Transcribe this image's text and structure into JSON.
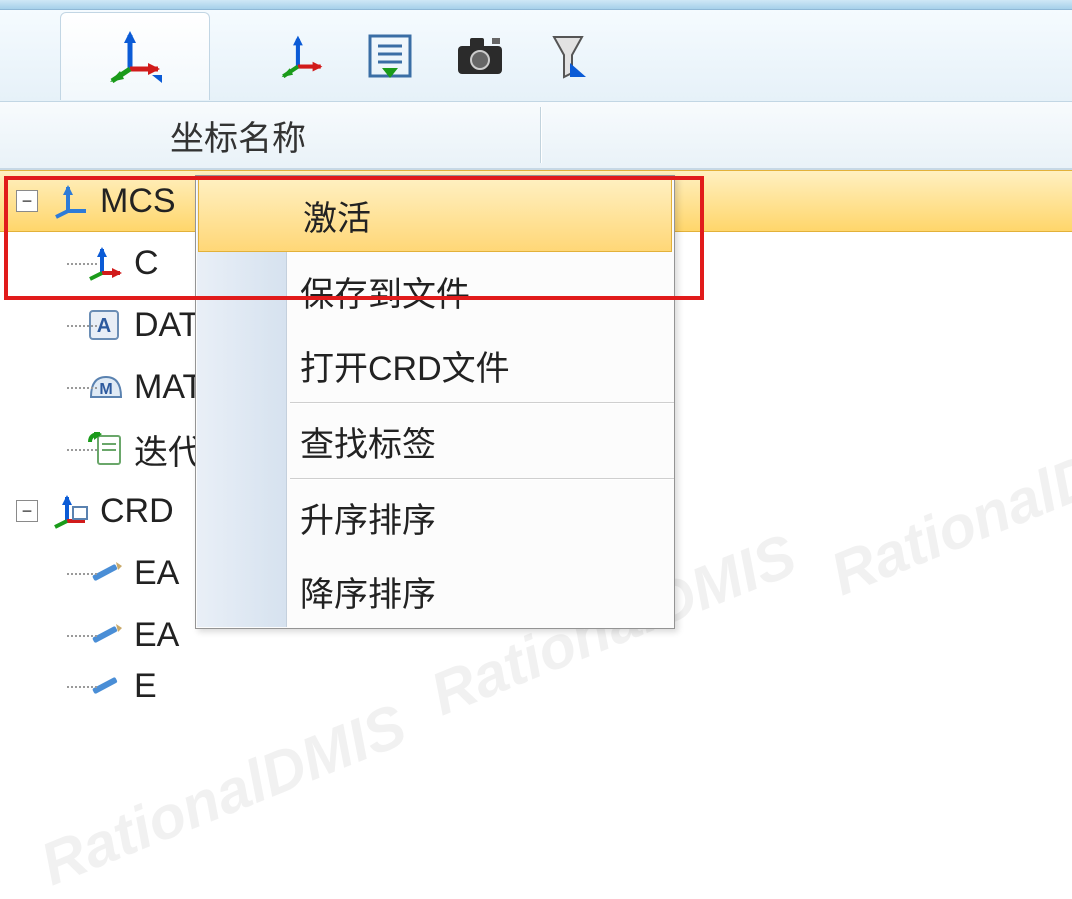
{
  "header": {
    "column_label": "坐标名称"
  },
  "toolbar": {
    "axis_icon_name": "coordinate-axis-icon",
    "list_icon_name": "list-arrow-icon",
    "camera_icon_name": "camera-icon",
    "filter_icon_name": "filter-funnel-icon"
  },
  "tree": {
    "items": [
      {
        "label": "MCS",
        "icon": "axis-blue-icon",
        "expandable": true,
        "expanded": true,
        "depth": 0,
        "selected": true
      },
      {
        "label": "C",
        "icon": "axis-color-icon",
        "expandable": false,
        "depth": 1
      },
      {
        "label": "DAT",
        "icon": "letter-a-box-icon",
        "expandable": false,
        "depth": 1
      },
      {
        "label": "MAT",
        "icon": "letter-m-helmet-icon",
        "expandable": false,
        "depth": 1
      },
      {
        "label": "迭代",
        "icon": "green-arrow-doc-icon",
        "expandable": false,
        "depth": 1
      },
      {
        "label": "CRD",
        "icon": "coordinate-box-icon",
        "expandable": true,
        "expanded": true,
        "depth": 0
      },
      {
        "label": "EA",
        "icon": "pencil-icon",
        "expandable": false,
        "depth": 1
      },
      {
        "label": "EA",
        "icon": "pencil-icon",
        "expandable": false,
        "depth": 1
      },
      {
        "label": "E",
        "icon": "pencil-icon",
        "expandable": false,
        "depth": 1
      }
    ]
  },
  "context_menu": {
    "items": [
      {
        "label": "激活",
        "hovered": true
      },
      {
        "label": "保存到文件"
      },
      {
        "label": "打开CRD文件"
      }
    ],
    "separator1": true,
    "items2": [
      {
        "label": "查找标签"
      }
    ],
    "separator2": true,
    "items3": [
      {
        "label": "升序排序"
      },
      {
        "label": "降序排序"
      }
    ]
  },
  "watermark_text": "RationalDMIS"
}
